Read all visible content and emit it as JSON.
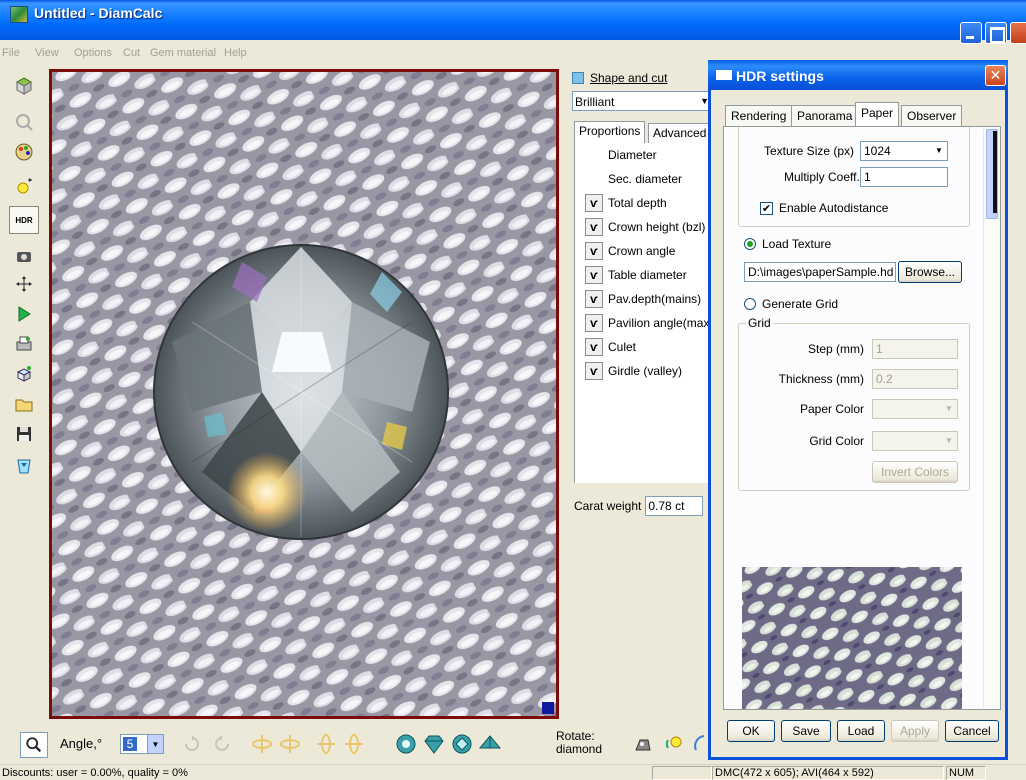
{
  "window": {
    "title": "Untitled - DiamCalc"
  },
  "menu": [
    "File",
    "View",
    "Options",
    "Cut",
    "Gem material",
    "Help"
  ],
  "left_toolbar": {
    "hdr_label": "HDR",
    "buttons": [
      "load-model-icon",
      "zoom-icon",
      "palette-icon",
      "light-icon",
      "hdr-icon",
      "camera-icon",
      "move-icon",
      "play-icon",
      "print-setup-icon",
      "export-icon",
      "open-folder-icon",
      "save-icon",
      "gem-trash-icon"
    ]
  },
  "bottom_bar": {
    "angle_label": "Angle,°",
    "angle_value": "5",
    "rotate_label_1": "Rotate:",
    "rotate_label_2": "diamond"
  },
  "status": {
    "text": "Discounts: user = 0.00%, quality = 0%",
    "dims": "DMC(472 x 605); AVI(464 x 592)",
    "num": "NUM"
  },
  "side_panel": {
    "header": "Shape and cut",
    "shape": "Brilliant",
    "tabs": [
      "Proportions",
      "Advanced"
    ],
    "items": [
      {
        "label": "Diameter",
        "icon": false
      },
      {
        "label": "Sec. diameter",
        "icon": false
      },
      {
        "label": "Total depth",
        "icon": true
      },
      {
        "label": "Crown height (bzl)",
        "icon": true
      },
      {
        "label": "Crown angle",
        "icon": true
      },
      {
        "label": "Table diameter",
        "icon": true
      },
      {
        "label": "Pav.depth(mains)",
        "icon": true
      },
      {
        "label": "Pavilion angle(max)",
        "icon": true
      },
      {
        "label": "Culet",
        "icon": true
      },
      {
        "label": "Girdle (valley)",
        "icon": true
      }
    ],
    "carat_label": "Carat weight",
    "carat_value": "0.78 ct"
  },
  "dialog": {
    "title": "HDR settings",
    "tabs": [
      "Rendering",
      "Panorama",
      "Paper",
      "Observer"
    ],
    "active_tab": "Paper",
    "texture_size_label": "Texture Size (px)",
    "texture_size_value": "1024",
    "multiply_label": "Multiply Coeff.",
    "multiply_value": "1",
    "autodistance_label": "Enable Autodistance",
    "load_texture_label": "Load Texture",
    "texture_path": "D:\\images\\paperSample.hd",
    "browse_label": "Browse...",
    "generate_grid_label": "Generate Grid",
    "grid_group_label": "Grid",
    "step_label": "Step (mm)",
    "step_value": "1",
    "thickness_label": "Thickness (mm)",
    "thickness_value": "0.2",
    "paper_color_label": "Paper Color",
    "grid_color_label": "Grid Color",
    "invert_label": "Invert Colors",
    "buttons": {
      "ok": "OK",
      "save": "Save",
      "load": "Load",
      "apply": "Apply",
      "cancel": "Cancel"
    }
  }
}
